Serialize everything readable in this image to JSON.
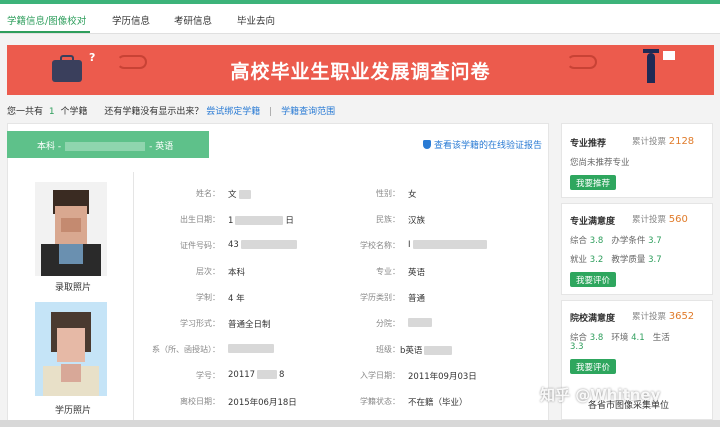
{
  "nav": {
    "items": [
      {
        "label": "学籍信息/图像校对",
        "active": true
      },
      {
        "label": "学历信息"
      },
      {
        "label": "考研信息"
      },
      {
        "label": "毕业去向"
      }
    ]
  },
  "banner": {
    "title": "高校毕业生职业发展调查问卷"
  },
  "info": {
    "prefix": "您一共有",
    "count": "1",
    "suffix": "个学籍",
    "question": "还有学籍没有显示出来？",
    "bind_link": "尝试绑定学籍",
    "scope_link": "学籍查询范围"
  },
  "record": {
    "tab_prefix": "本科 -",
    "tab_suffix": "- 英语",
    "verify_link": "查看该学籍的在线验证报告",
    "photo1_label": "录取照片",
    "photo2_label": "学历照片",
    "fields_left": [
      {
        "label": "姓名：",
        "value": "文"
      },
      {
        "label": "出生日期：",
        "value": "1",
        "value_tail": "日"
      },
      {
        "label": "证件号码：",
        "value": "43"
      },
      {
        "label": "层次：",
        "value": "本科"
      },
      {
        "label": "学制：",
        "value": "4 年"
      },
      {
        "label": "学习形式：",
        "value": "普通全日制"
      },
      {
        "label": "系（所、函授站）：",
        "value": ""
      },
      {
        "label": "学号：",
        "value": "20117",
        "value_tail": "8"
      },
      {
        "label": "离校日期：",
        "value": "2015年06月18日"
      }
    ],
    "fields_right": [
      {
        "label": "性别：",
        "value": "女"
      },
      {
        "label": "民族：",
        "value": "汉族"
      },
      {
        "label": "学校名称：",
        "value": "I"
      },
      {
        "label": "专业：",
        "value": "英语"
      },
      {
        "label": "学历类别：",
        "value": "普通"
      },
      {
        "label": "分院：",
        "value": ""
      },
      {
        "label": "班级：",
        "value": "b英语"
      },
      {
        "label": "入学日期：",
        "value": "2011年09月03日"
      },
      {
        "label": "学籍状态：",
        "value": "不在籍（毕业）"
      }
    ]
  },
  "sidebar": {
    "recommend": {
      "title": "专业推荐",
      "votes_label": "累计投票",
      "votes": "2128",
      "text": "您尚未推荐专业",
      "button": "我要推荐"
    },
    "major_satisfaction": {
      "title": "专业满意度",
      "votes_label": "累计投票",
      "votes": "560",
      "row1_a_label": "综合",
      "row1_a_score": "3.8",
      "row1_b_label": "办学条件",
      "row1_b_score": "3.7",
      "row2_a_label": "就业",
      "row2_a_score": "3.2",
      "row2_b_label": "教学质量",
      "row2_b_score": "3.7",
      "button": "我要评价"
    },
    "school_satisfaction": {
      "title": "院校满意度",
      "votes_label": "累计投票",
      "votes": "3652",
      "row1_a_label": "综合",
      "row1_a_score": "3.8",
      "row1_b_label": "环境",
      "row1_b_score": "4.1",
      "row1_c_label": "生活",
      "row1_c_score": "3.3",
      "button": "我要评价"
    }
  },
  "watermark": "知乎 @Whitney",
  "bottom_text": "各省市图像采集单位"
}
